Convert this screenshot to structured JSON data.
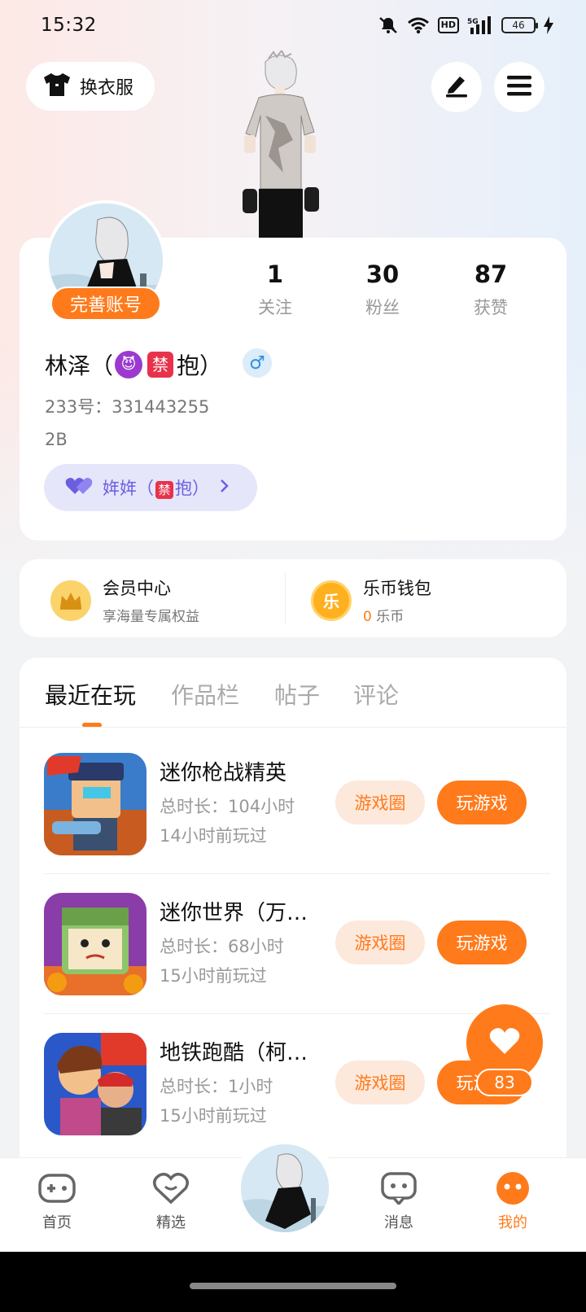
{
  "status_bar": {
    "time": "15:32",
    "hd": "HD",
    "network": "5G",
    "battery": "46"
  },
  "header": {
    "dress_label": "换衣服"
  },
  "profile": {
    "complete_label": "完善账号",
    "stats": [
      {
        "num": "1",
        "label": "关注"
      },
      {
        "num": "30",
        "label": "粉丝"
      },
      {
        "num": "87",
        "label": "获赞"
      }
    ],
    "name_prefix": "林泽（",
    "name_emoji_devil": "😈",
    "name_emoji_ban": "禁",
    "name_suffix": "抱）",
    "gender": "♂",
    "uid": "233号：331443255",
    "bio": "2B",
    "cp_prefix": "姩姩（",
    "cp_ban": "禁",
    "cp_suffix": "抱）"
  },
  "vip": {
    "member_title": "会员中心",
    "member_sub": "享海量专属权益",
    "wallet_title": "乐币钱包",
    "wallet_amount": "0",
    "wallet_unit": " 乐币",
    "coin_char": "乐"
  },
  "tabs": [
    "最近在玩",
    "作品栏",
    "帖子",
    "评论"
  ],
  "games": [
    {
      "name": "迷你枪战精英",
      "duration": "总时长：104小时",
      "last_played": "14小时前玩过",
      "circle_label": "游戏圈",
      "play_label": "玩游戏"
    },
    {
      "name": "迷你世界（万…",
      "duration": "总时长：68小时",
      "last_played": "15小时前玩过",
      "circle_label": "游戏圈",
      "play_label": "玩游戏"
    },
    {
      "name": "地铁跑酷（柯…",
      "duration": "总时长：1小时",
      "last_played": "15小时前玩过",
      "circle_label": "游戏圈",
      "play_label": "玩游戏"
    }
  ],
  "float_like": {
    "count": "83"
  },
  "nav": [
    {
      "label": "首页"
    },
    {
      "label": "精选"
    },
    {
      "label": "消息"
    },
    {
      "label": "我的"
    }
  ],
  "colors": {
    "accent": "#ff7a1a",
    "cp_purple": "#6b5fe0",
    "gender_blue": "#2c8fe6"
  }
}
